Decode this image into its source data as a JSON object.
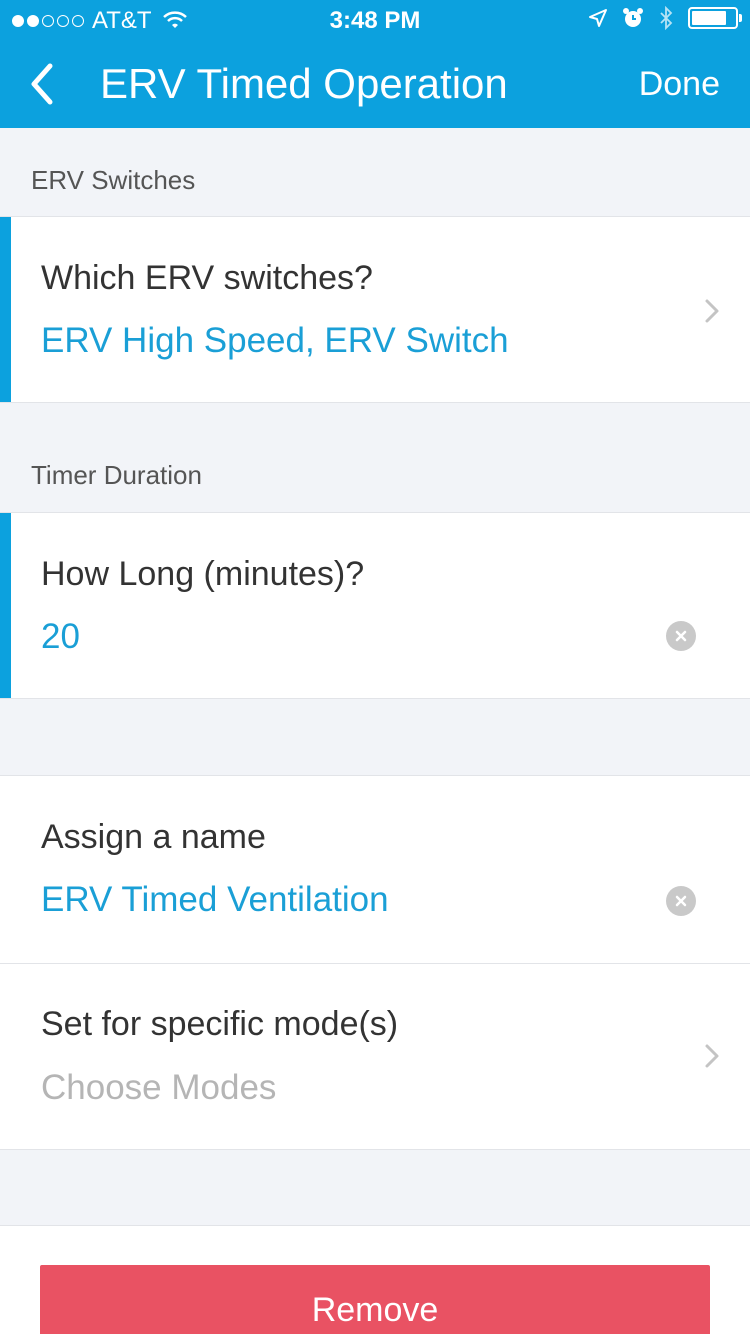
{
  "status_bar": {
    "carrier": "AT&T",
    "time": "3:48 PM",
    "signal_icon": "signal-dots-icon",
    "wifi_icon": "wifi-icon",
    "location_icon": "location-arrow-icon",
    "alarm_icon": "alarm-icon",
    "bluetooth_icon": "bluetooth-icon",
    "battery_icon": "battery-icon"
  },
  "nav": {
    "back_icon": "chevron-left-icon",
    "title": "ERV Timed Operation",
    "done_label": "Done"
  },
  "sections": {
    "erv_switches": {
      "header": "ERV Switches",
      "label": "Which ERV switches?",
      "value": "ERV High Speed, ERV Switch"
    },
    "timer_duration": {
      "header": "Timer Duration",
      "label": "How Long (minutes)?",
      "value": "20"
    },
    "name": {
      "label": "Assign a name",
      "value": "ERV Timed Ventilation"
    },
    "modes": {
      "label": "Set for specific mode(s)",
      "placeholder": "Choose Modes"
    }
  },
  "remove_label": "Remove",
  "colors": {
    "accent": "#0ca1de",
    "value_text": "#1a9fd6",
    "remove": "#e95263",
    "background": "#f2f4f8"
  }
}
